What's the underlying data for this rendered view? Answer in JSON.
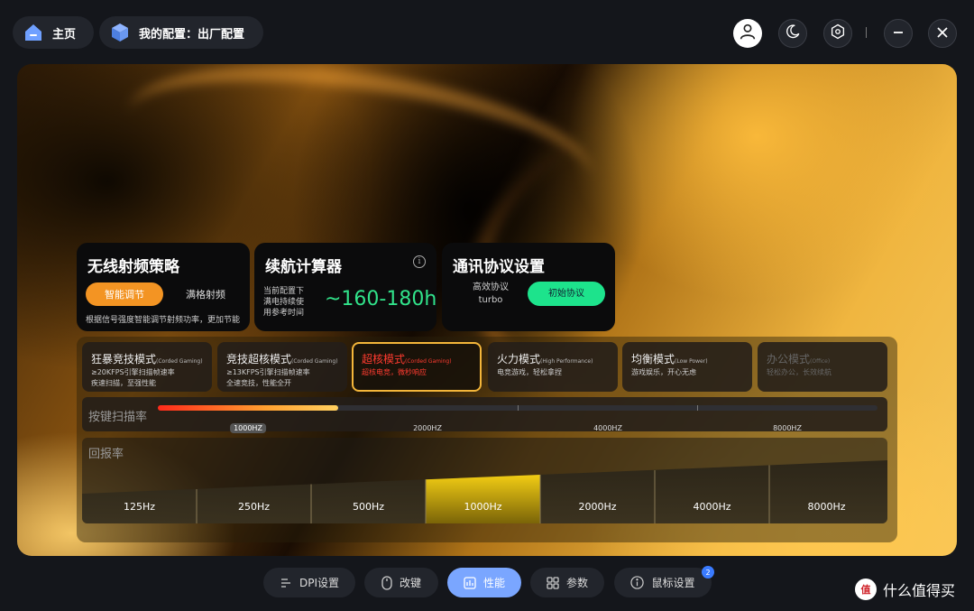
{
  "header": {
    "home_label": "主页",
    "config_label": "我的配置：出厂配置",
    "icons": [
      "home-icon",
      "cube-icon",
      "user-icon",
      "moon-icon",
      "gear-icon",
      "minimize-icon",
      "close-icon"
    ]
  },
  "wireless": {
    "title": "无线射频策略",
    "smart_label": "智能调节",
    "full_label": "满格射频",
    "description": "根据信号强度智能调节射频功率，更加节能"
  },
  "battery": {
    "title": "续航计算器",
    "line1": "当前配置下",
    "line2": "满电持续使",
    "line3": "用参考时间",
    "value": "~160-180h"
  },
  "protocol": {
    "title": "通讯协议设置",
    "efficient_label": "高效协议",
    "efficient_sub": "turbo",
    "initial_label": "初始协议"
  },
  "modes": [
    {
      "title": "狂暴竞技模式",
      "sub": "(Corded Gaming)",
      "line1": "≥20KFPS引擎扫描帧速率",
      "line2": "疾速扫描，至强性能"
    },
    {
      "title": "竞技超核模式",
      "sub": "(Corded Gaming)",
      "line1": "≥13KFPS引擎扫描帧速率",
      "line2": "全速竞技，性能全开"
    },
    {
      "title": "超核模式",
      "sub": "(Corded Gaming)",
      "line1": "超核电竞，微秒响应",
      "line2": ""
    },
    {
      "title": "火力模式",
      "sub": "(High Performance)",
      "line1": "电竞游戏，轻松拿捏",
      "line2": ""
    },
    {
      "title": "均衡模式",
      "sub": "(Low Power)",
      "line1": "游戏娱乐，开心无虑",
      "line2": ""
    },
    {
      "title": "办公模式",
      "sub": "(Office)",
      "line1": "轻松办公，长效续航",
      "line2": ""
    }
  ],
  "scan_rate": {
    "label": "按键扫描率",
    "marks": [
      "1000HZ",
      "2000HZ",
      "4000HZ",
      "8000HZ"
    ],
    "selected_fraction": 0.25
  },
  "report_rate": {
    "label": "回报率",
    "options": [
      "125Hz",
      "250Hz",
      "500Hz",
      "1000Hz",
      "2000Hz",
      "4000Hz",
      "8000Hz"
    ],
    "selected": "1000Hz"
  },
  "tabs": {
    "dpi": "DPI设置",
    "keys": "改键",
    "perf": "性能",
    "params": "参数",
    "mouse": "鼠标设置",
    "badge": "2"
  },
  "watermark": {
    "logo": "值",
    "text": "什么值得买"
  },
  "colors": {
    "accent_orange": "#f39423",
    "accent_green": "#1de38c",
    "value_green": "#31e28a",
    "active_tab": "#7aa6ff",
    "active_mode_text": "#ff3b30",
    "active_mode_border": "#f4b63a"
  }
}
